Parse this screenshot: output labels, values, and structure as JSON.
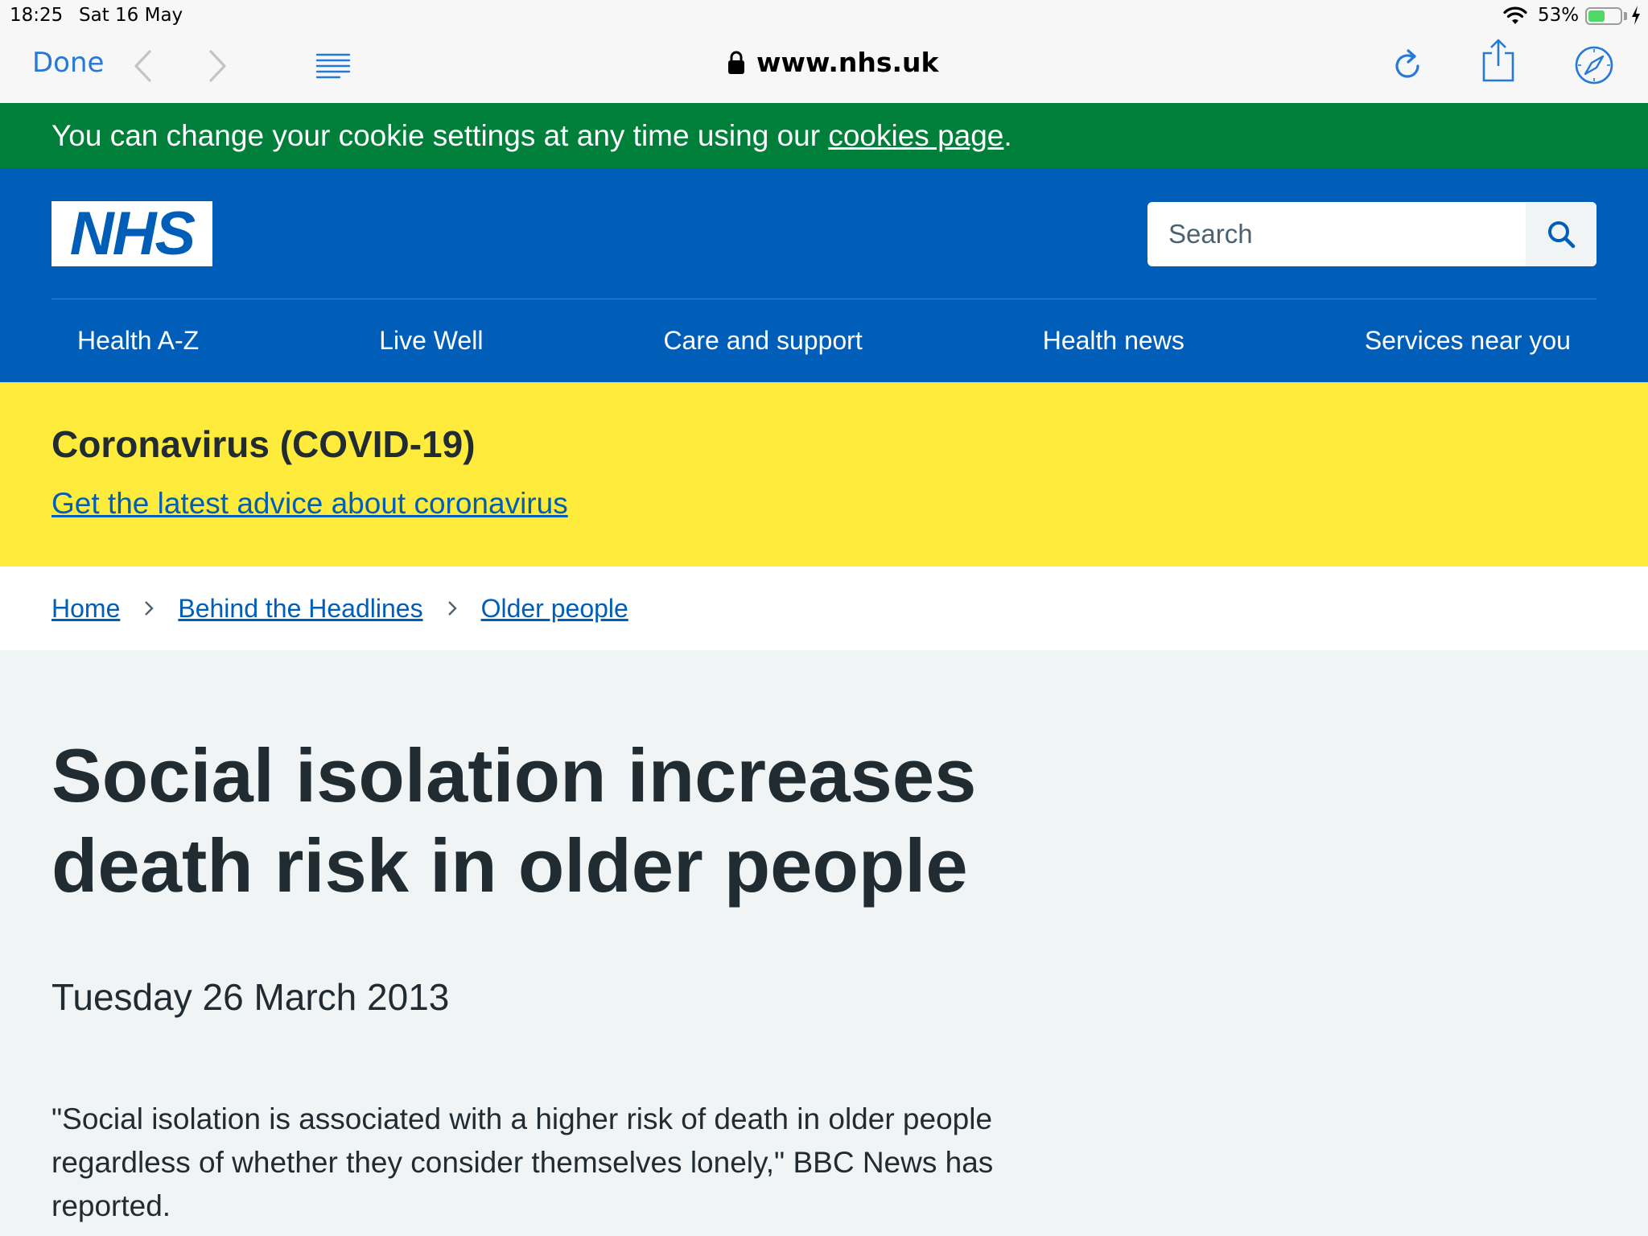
{
  "status_bar": {
    "time": "18:25",
    "date": "Sat 16 May",
    "battery_percent": "53%",
    "battery_level": 0.53
  },
  "browser": {
    "done_label": "Done",
    "url": "www.nhs.uk",
    "icons": [
      "back-icon",
      "forward-icon",
      "reader-icon",
      "lock-icon",
      "reload-icon",
      "share-icon",
      "safari-compass-icon"
    ]
  },
  "cookie_banner": {
    "text": "You can change your cookie settings at any time using our ",
    "link": "cookies page",
    "suffix": "."
  },
  "header": {
    "logo_text": "NHS",
    "search_placeholder": "Search",
    "nav": [
      "Health A-Z",
      "Live Well",
      "Care and support",
      "Health news",
      "Services near you"
    ]
  },
  "covid": {
    "title": "Coronavirus (COVID-19)",
    "link": "Get the latest advice about coronavirus"
  },
  "breadcrumb": [
    "Home",
    "Behind the Headlines",
    "Older people"
  ],
  "article": {
    "title": "Social isolation increases death risk in older people",
    "date": "Tuesday 26 March 2013",
    "lead": "\"Social isolation is associated with a higher risk of death in older people regardless of whether they consider themselves lonely,\" BBC News has reported."
  },
  "colors": {
    "nhs_blue": "#005eb8",
    "cookie_green": "#007f3b",
    "covid_yellow": "#ffeb3b",
    "ios_tint": "#2678d9",
    "text": "#212b32",
    "page_bg": "#f0f4f5"
  }
}
